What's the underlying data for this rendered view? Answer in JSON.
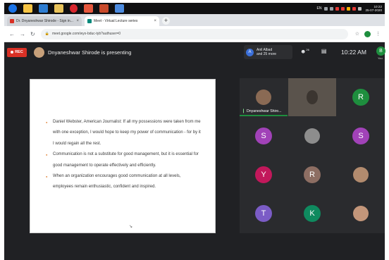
{
  "taskbar": {
    "clock_time": "10:22",
    "clock_date": "25-07-2020",
    "lang": "EN"
  },
  "browser": {
    "tabs": [
      {
        "label": "Dr. Dnyaneshwar Shirode - Sign in..."
      },
      {
        "label": "Meet - Virtual Lecture series"
      }
    ],
    "tab_close_glyph": "×",
    "new_tab_glyph": "+",
    "url": "meet.google.com/wyx-bduc-tyb?authuser=0"
  },
  "meet": {
    "rec_label": "REC",
    "presenting_text": "Dnyaneshwar Shirode is presenting",
    "people_chip": {
      "line1": "Anil Albad",
      "line2": "and 25 more",
      "avatar_letter": "A"
    },
    "participants_count": "26",
    "time": "10:22 AM",
    "self_avatar_letter": "B",
    "self_label": "You"
  },
  "slide": {
    "bullets": [
      "Daniel Webster, American Journalist: If all my possessions were taken from me with one exception, I would hope to keep my power of communication - for by it I would regain all the rest.",
      "Communication is not a substitute for good management, but it is essential for good management to operate effectively and efficiently.",
      "When an organization encourages good communication at all levels, employees remain enthusiastic, confident and inspired."
    ]
  },
  "tiles": [
    {
      "type": "photo",
      "name": "Dnyaneshwar Shiro...",
      "color": "#8a6a54"
    },
    {
      "type": "video",
      "color": "#5a534c"
    },
    {
      "type": "letter",
      "letter": "R",
      "color": "#1e8e3e"
    },
    {
      "type": "letter",
      "letter": "S",
      "color": "#a142b8"
    },
    {
      "type": "photo",
      "color": "#8d8d8d"
    },
    {
      "type": "letter",
      "letter": "S",
      "color": "#a142b8"
    },
    {
      "type": "letter",
      "letter": "Y",
      "color": "#c2185b"
    },
    {
      "type": "letter",
      "letter": "R",
      "color": "#8d6e63"
    },
    {
      "type": "photo",
      "color": "#b28b6e"
    },
    {
      "type": "letter",
      "letter": "T",
      "color": "#7b5cc6"
    },
    {
      "type": "letter",
      "letter": "K",
      "color": "#0f8a5f"
    },
    {
      "type": "photo",
      "color": "#c3967a"
    }
  ]
}
